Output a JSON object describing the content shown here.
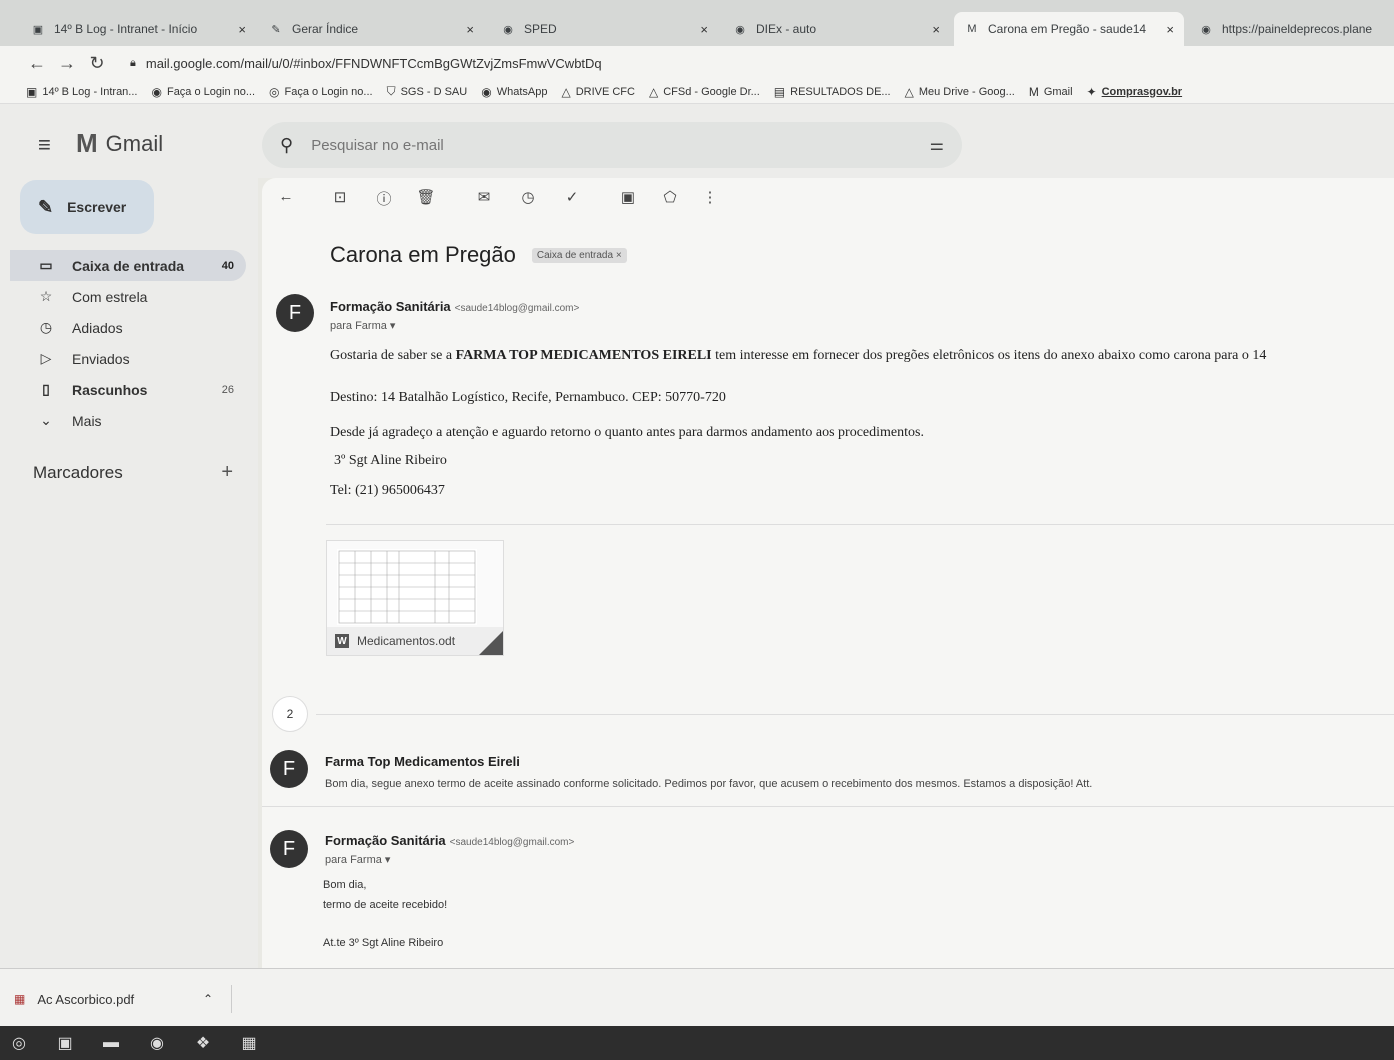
{
  "tabs": [
    {
      "title": "14º B Log - Intranet - Início",
      "close": "×"
    },
    {
      "title": "Gerar Índice",
      "close": "×"
    },
    {
      "title": "SPED",
      "close": "×"
    },
    {
      "title": "DIEx - auto",
      "close": "×"
    },
    {
      "title": "Carona em Pregão - saude14",
      "close": "×"
    },
    {
      "title": "https://paineldeprecos.plane",
      "close": ""
    }
  ],
  "address": {
    "url": "mail.google.com/mail/u/0/#inbox/FFNDWNFTCcmBgGWtZvjZmsFmwVCwbtDq"
  },
  "bookmarks": [
    "14º B Log - Intran...",
    "Faça o Login no...",
    "Faça o Login no...",
    "SGS - D SAU",
    "WhatsApp",
    "DRIVE CFC",
    "CFSd - Google Dr...",
    "RESULTADOS DE...",
    "Meu Drive - Goog...",
    "Gmail",
    "Comprasgov.br"
  ],
  "gmail": {
    "title": "Gmail"
  },
  "search": {
    "placeholder": "Pesquisar no e-mail"
  },
  "compose": {
    "label": "Escrever"
  },
  "nav": [
    {
      "label": "Caixa de entrada",
      "count": "40"
    },
    {
      "label": "Com estrela",
      "count": ""
    },
    {
      "label": "Adiados",
      "count": ""
    },
    {
      "label": "Enviados",
      "count": ""
    },
    {
      "label": "Rascunhos",
      "count": "26"
    },
    {
      "label": "Mais",
      "count": ""
    }
  ],
  "markers": {
    "label": "Marcadores",
    "add": "+"
  },
  "thread": {
    "subject": "Carona em Pregão",
    "label_chip": "Caixa de entrada ×",
    "collapsed_count": "2"
  },
  "msg1": {
    "avatar": "F",
    "sender": "Formação Sanitária",
    "email": "<saude14blog@gmail.com>",
    "to": "para Farma ▾",
    "p1_pre": "Gostaria de saber se a ",
    "p1_bold": "FARMA TOP MEDICAMENTOS EIRELI",
    "p1_post": " tem interesse em fornecer dos pregões eletrônicos os itens do anexo abaixo como carona para o 14",
    "p2": "Destino: 14 Batalhão Logístico, Recife, Pernambuco. CEP: 50770-720",
    "p3": "Desde já agradeço a atenção e aguardo retorno o quanto antes para darmos andamento aos procedimentos.",
    "p4": "3º Sgt Aline Ribeiro",
    "p5": "Tel: (21) 965006437",
    "attachment": "Medicamentos.odt"
  },
  "msg2": {
    "avatar": "F",
    "sender": "Farma Top Medicamentos Eireli",
    "snippet": "Bom dia, segue anexo termo de aceite assinado conforme solicitado. Pedimos por favor, que acusem o recebimento dos mesmos. Estamos a disposição! Att."
  },
  "msg3": {
    "avatar": "F",
    "sender": "Formação Sanitária",
    "email": "<saude14blog@gmail.com>",
    "to": "para Farma ▾",
    "l1": "Bom dia,",
    "l2": "termo de aceite recebido!",
    "l3": "At.te  3º Sgt Aline Ribeiro"
  },
  "download": {
    "filename": "Ac Ascorbico.pdf"
  }
}
